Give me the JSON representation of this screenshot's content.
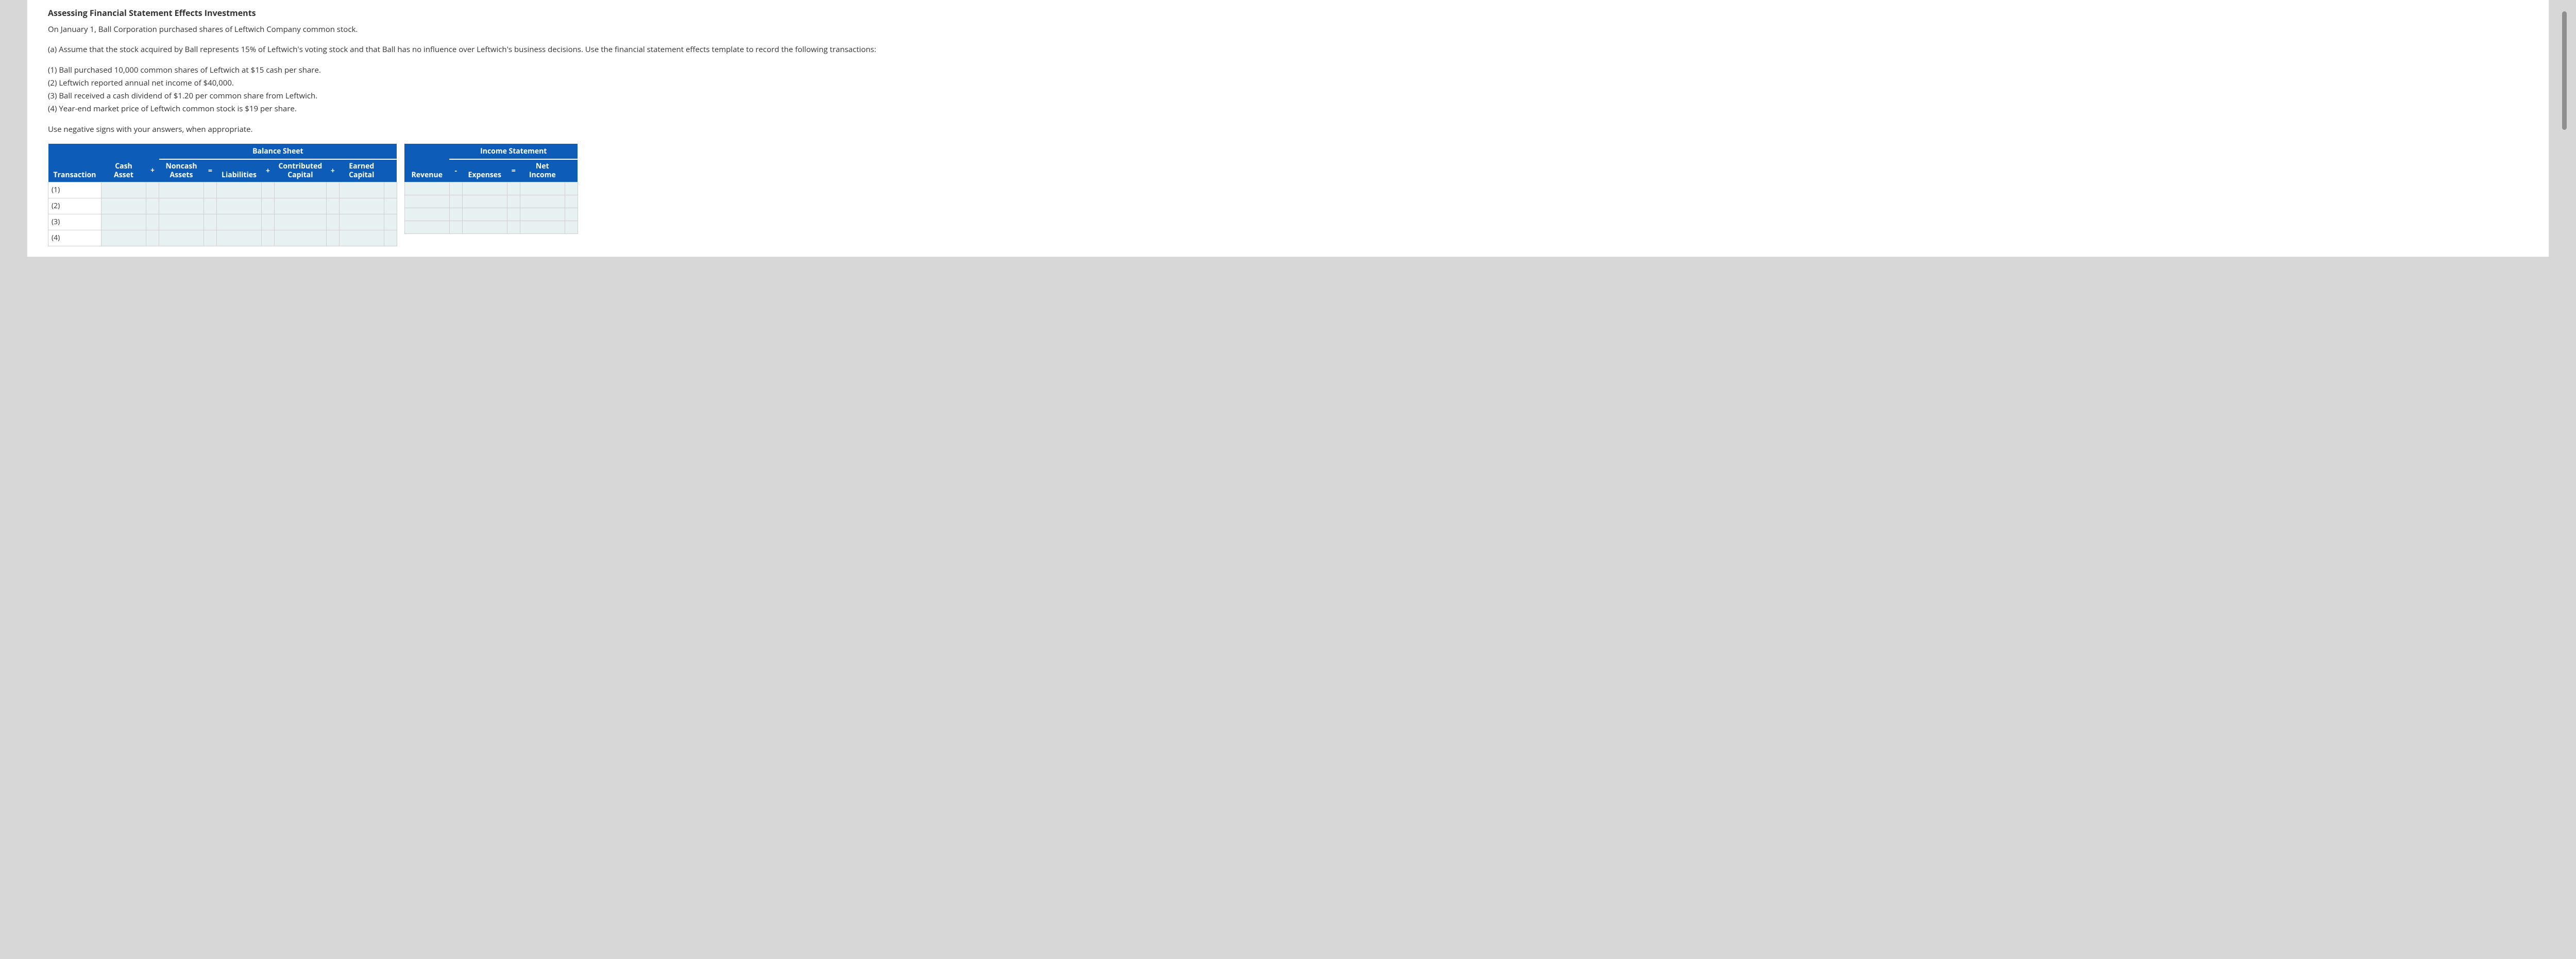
{
  "title": "Assessing Financial Statement Effects Investments",
  "intro": "On January 1, Ball Corporation purchased shares of Leftwich Company common stock.",
  "part_a": "(a) Assume that the stock acquired by Ball represents 15% of Leftwich's voting stock and that Ball has no influence over Leftwich's business decisions. Use the financial statement effects template to record the following transactions:",
  "items": {
    "i1": "(1) Ball purchased 10,000 common shares of Leftwich at $15 cash per share.",
    "i2": "(2) Leftwich reported annual net income of $40,000.",
    "i3": "(3) Ball received a cash dividend of $1.20 per common share from Leftwich.",
    "i4": "(4) Year-end market price of Leftwich common stock is $19 per share."
  },
  "note": "Use negative signs with your answers, when appropriate.",
  "bs": {
    "super": "Balance Sheet",
    "cols": {
      "txn": "Transaction",
      "cash": "Cash Asset",
      "noncash_l1": "Noncash",
      "noncash_l2": "Assets",
      "liab": "Liabilities",
      "contrib_l1": "Contributed",
      "contrib_l2": "Capital",
      "earned_l1": "Earned",
      "earned_l2": "Capital"
    },
    "ops": {
      "plus": "+",
      "eq": "="
    },
    "rows": [
      "(1)",
      "(2)",
      "(3)",
      "(4)"
    ]
  },
  "is": {
    "super": "Income Statement",
    "cols": {
      "rev": "Revenue",
      "exp": "Expenses",
      "net_l1": "Net",
      "net_l2": "Income"
    },
    "ops": {
      "minus": "-",
      "eq": "="
    }
  }
}
